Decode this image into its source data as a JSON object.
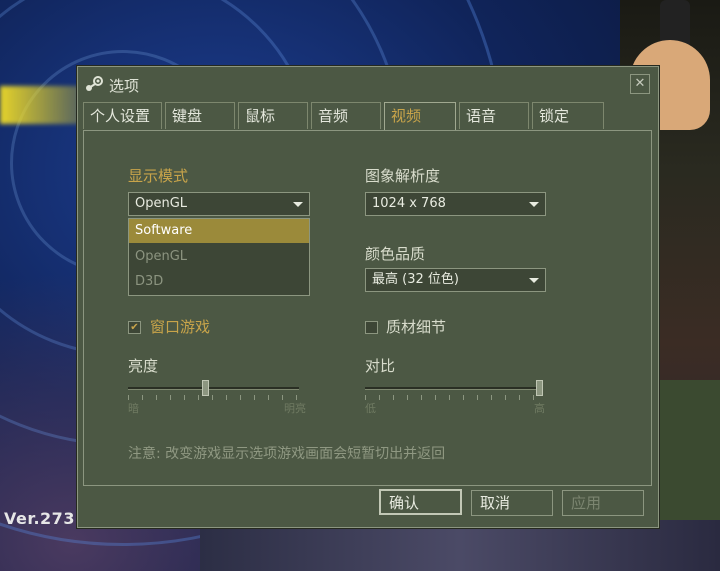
{
  "background": {
    "version_text": "Ver.273"
  },
  "dialog": {
    "title": "选项",
    "close_glyph": "✕",
    "tabs": [
      {
        "label": "个人设置"
      },
      {
        "label": "键盘"
      },
      {
        "label": "鼠标"
      },
      {
        "label": "音频"
      },
      {
        "label": "视频",
        "active": true
      },
      {
        "label": "语音"
      },
      {
        "label": "锁定"
      }
    ],
    "display_mode": {
      "label": "显示模式",
      "value": "OpenGL",
      "options": [
        "Software",
        "OpenGL",
        "D3D"
      ],
      "highlighted": "Software"
    },
    "resolution": {
      "label": "图象解析度",
      "value": "1024 x 768"
    },
    "color_quality": {
      "label": "颜色品质",
      "value": "最高 (32 位色)"
    },
    "windowed": {
      "label": "窗口游戏",
      "checked": true,
      "check_glyph": "✔"
    },
    "detail_textures": {
      "label": "质材细节",
      "checked": false
    },
    "brightness": {
      "label": "亮度",
      "min_label": "暗",
      "max_label": "明亮",
      "level": 0.45
    },
    "contrast": {
      "label": "对比",
      "min_label": "低",
      "max_label": "高",
      "level": 1.0
    },
    "note": "注意: 改变游戏显示选项游戏画面会短暂切出并返回",
    "buttons": {
      "ok": "确认",
      "cancel": "取消",
      "apply": "应用"
    }
  },
  "colors": {
    "accent": "#c8a44a",
    "panel": "#4c5844",
    "highlight": "#9b8a3a"
  }
}
